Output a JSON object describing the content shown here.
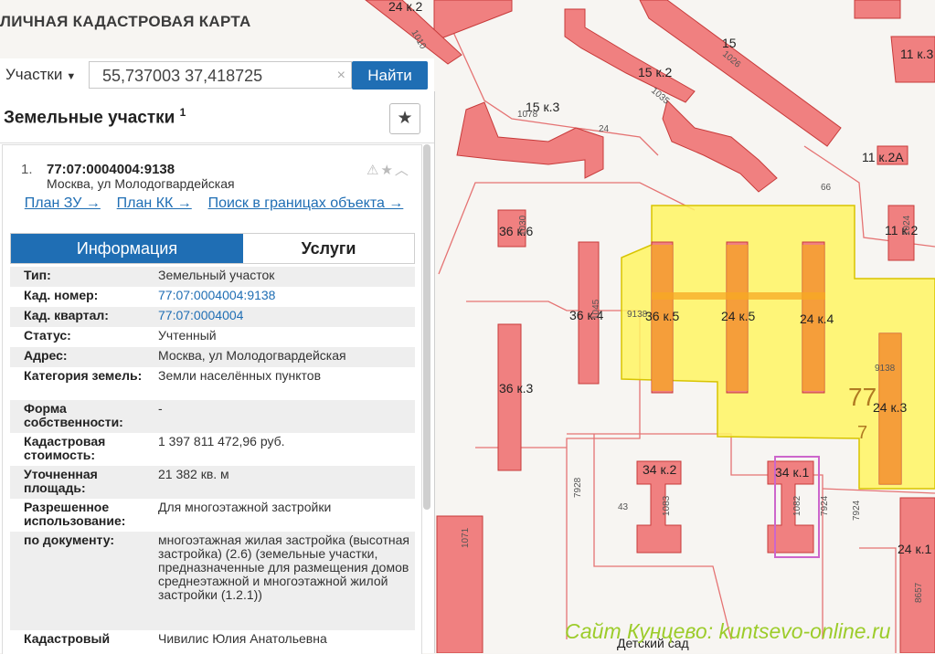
{
  "app": {
    "title": "ЛИЧНАЯ КАДАСТРОВАЯ КАРТА"
  },
  "search": {
    "type": "Участки",
    "query": "55,737003 37,418725",
    "clear_icon": "×",
    "button": "Найти"
  },
  "panel": {
    "title": "Земельные участки",
    "count": "1",
    "result": {
      "number": "1.",
      "cadnum": "77:07:0004004:9138",
      "address": "Москва, ул Молодогвардейская",
      "links": [
        "План ЗУ →",
        "План КК →",
        "Поиск в границах объекта →"
      ]
    },
    "tabs": {
      "info": "Информация",
      "services": "Услуги"
    },
    "props": [
      {
        "key": "Тип:",
        "value": "Земельный участок"
      },
      {
        "key": "Кад. номер:",
        "value": "77:07:0004004:9138"
      },
      {
        "key": "Кад. квартал:",
        "value": "77:07:0004004"
      },
      {
        "key": "Статус:",
        "value": "Учтенный"
      },
      {
        "key": "Адрес:",
        "value": "Москва, ул Молодогвардейская"
      },
      {
        "key": "Категория земель:",
        "value": "Земли населённых пунктов"
      },
      {
        "key": "Форма собственности:",
        "value": "-"
      },
      {
        "key": "Кадастровая стоимость:",
        "value": "1 397 811 472,96 руб."
      },
      {
        "key": "Уточненная площадь:",
        "value": "21 382 кв. м"
      },
      {
        "key": "Разрешенное использование:",
        "value": "Для многоэтажной застройки"
      },
      {
        "key": "по документу:",
        "value": "многоэтажная жилая застройка (высотная застройка) (2.6) (земельные участки, предназначенные для размещения домов среднеэтажной и многоэтажной жилой застройки (1.2.1))"
      },
      {
        "key": "Кадастровый",
        "value": "Чивилис Юлия Анатольевна"
      }
    ]
  },
  "map": {
    "labels": {
      "b15": "15",
      "b15k2": "15 к.2",
      "b15k3": "15 к.3",
      "b24k2": "24 к.2",
      "b11k3": "11 к.3",
      "b11k2a": "11 к.2А",
      "b11k2": "11 к.2",
      "b36k6": "36 к.6",
      "b36k4": "36 к.4",
      "b36k5": "36 к.5",
      "b24k5": "24 к.5",
      "b24k4": "24 к.4",
      "b36k3": "36 к.3",
      "b24k3": "24 к.3",
      "b34k2": "34 к.2",
      "b34k1": "34 к.1",
      "b24k1": "24 к.1",
      "n24": "24",
      "n43": "43",
      "n9138a": "9138",
      "n9138b": "9138",
      "n7928": "7928",
      "n7924a": "7924",
      "n7924b": "7924",
      "n1083": "1083",
      "n1082": "1082",
      "n1010": "1010",
      "n1026": "1026",
      "n1035": "1035",
      "n1078": "1078",
      "n1030": "1030",
      "n1045": "1045",
      "n66": "66",
      "n1024": "1024",
      "n1071": "1071",
      "n8657": "8657",
      "q77": "77",
      "q7": "7",
      "kinder": "Детский сад"
    },
    "colors": {
      "building": "#f08080",
      "building_stroke": "#c73a3a",
      "parcel": "#fff563",
      "parcel_stroke": "#d8c400",
      "highlight": "#f7a823",
      "boundary": "#e57373"
    }
  },
  "watermark": "Сайт Кунцево: kuntsevo-online.ru"
}
